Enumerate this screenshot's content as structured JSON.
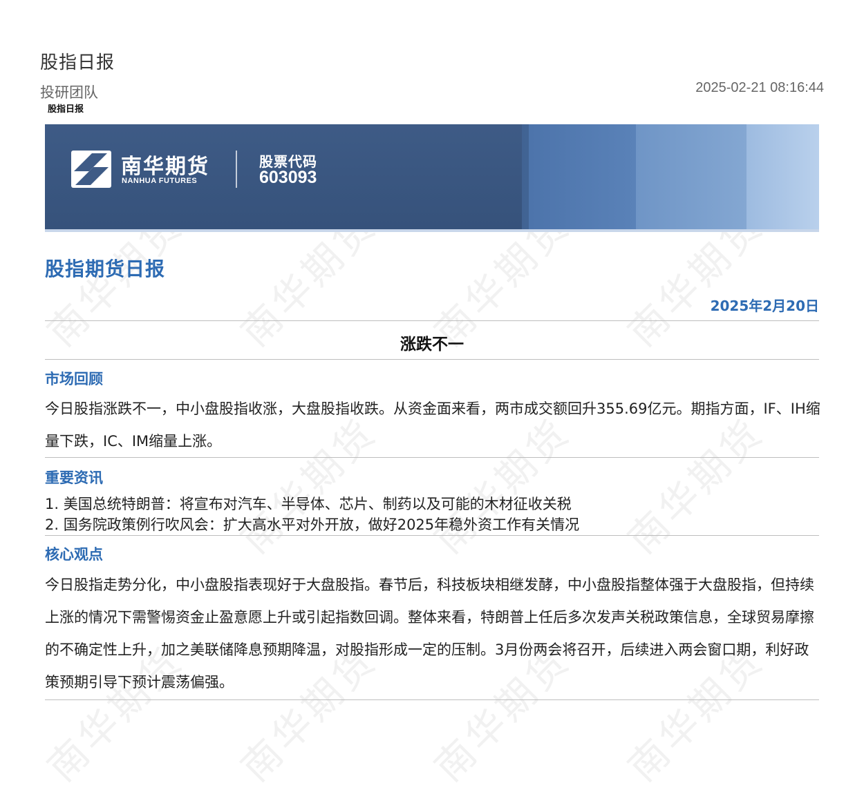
{
  "header": {
    "title": "股指日报",
    "author": "投研团队",
    "timestamp": "2025-02-21 08:16:44",
    "category_tag": "股指日报"
  },
  "banner": {
    "company_cn": "南华期货",
    "company_en": "NANHUA FUTURES",
    "stock_label": "股票代码",
    "stock_code": "603093",
    "colors": [
      "#3e5b86",
      "#4c73aa",
      "#6f95c6",
      "#9dbbe0"
    ]
  },
  "report": {
    "title": "股指期货日报",
    "date": "2025年2月20日",
    "headline": "涨跌不一"
  },
  "sections": {
    "market_review": {
      "title": "市场回顾",
      "text": "今日股指涨跌不一，中小盘股指收涨，大盘股指收跌。从资金面来看，两市成交额回升355.69亿元。期指方面，IF、IH缩量下跌，IC、IM缩量上涨。"
    },
    "important_news": {
      "title": "重要资讯",
      "items": [
        "1. 美国总统特朗普：将宣布对汽车、半导体、芯片、制药以及可能的木材征收关税",
        "2. 国务院政策例行吹风会：扩大高水平对外开放，做好2025年稳外资工作有关情况"
      ]
    },
    "core_view": {
      "title": "核心观点",
      "text": "今日股指走势分化，中小盘股指表现好于大盘股指。春节后，科技板块相继发酵，中小盘股指整体强于大盘股指，但持续上涨的情况下需警惕资金止盈意愿上升或引起指数回调。整体来看，特朗普上任后多次发声关税政策信息，全球贸易摩擦的不确定性上升，加之美联储降息预期降温，对股指形成一定的压制。3月份两会将召开，后续进入两会窗口期，利好政策预期引导下预计震荡偏强。"
    }
  },
  "watermark": {
    "text": "南华期货",
    "color": "#969696"
  },
  "colors": {
    "accent": "#2d6bb3",
    "divider": "#bdbdbd"
  }
}
